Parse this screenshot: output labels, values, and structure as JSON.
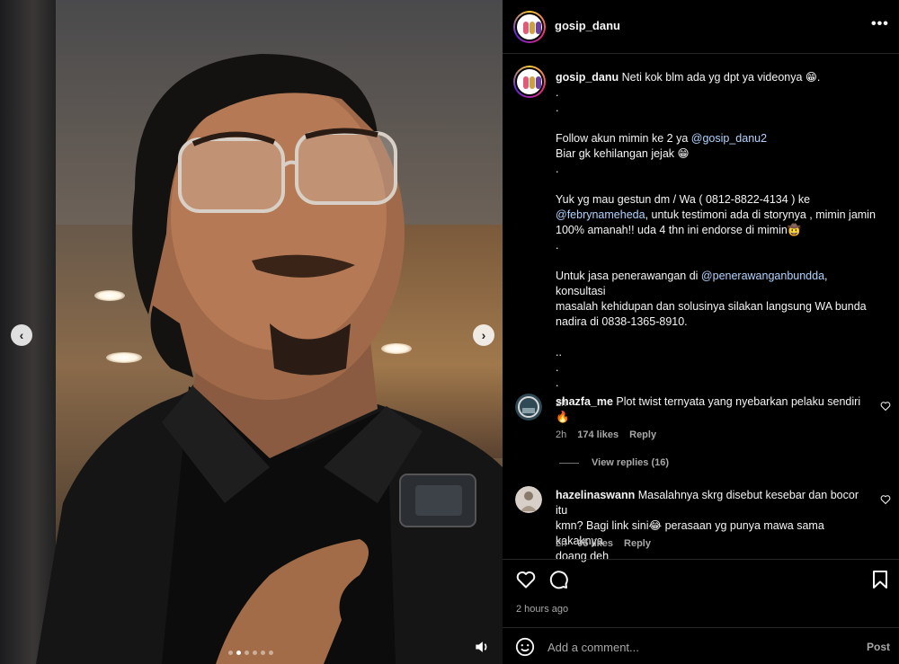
{
  "post": {
    "username": "gosip_danu",
    "more_label": "•••",
    "caption": {
      "username": "gosip_danu",
      "lines": [
        "Neti kok blm ada yg dpt ya videonya 😁.",
        ".",
        ".",
        "",
        "Follow akun mimin ke 2 ya @gosip_danu2",
        "Biar gk kehilangan jejak 😁",
        ".",
        "",
        "Yuk yg mau gestun dm / Wa ( 0812-8822-4134 ) ke",
        "@febrynameheda, untuk testimoni ada di storynya , mimin jamin",
        "100% amanah!! uda 4 thn ini endorse di mimin🤠",
        ".",
        "",
        "Untuk jasa penerawangan di @penerawanganbundda, konsultasi",
        "masalah kehidupan dan solusinya silakan langsung WA bunda",
        "nadira di 0838-1365-8910.",
        "",
        "..",
        ".",
        "."
      ],
      "time": "2h"
    },
    "comments": [
      {
        "username": "shazfa_me",
        "text": "Plot twist ternyata yang nyebarkan pelaku sendiri",
        "text2": "🔥",
        "time": "2h",
        "likes": "174 likes",
        "reply": "Reply",
        "view_replies": "View replies (16)"
      },
      {
        "username": "hazelinaswann",
        "text": "Masalahnya skrg disebut kesebar dan bocor itu",
        "text2": "kmn? Bagi link sini😂  perasaan yg punya mawa sama kakaknya",
        "text3": "doang deh",
        "time": "2h",
        "likes": "95 likes",
        "reply": "Reply"
      }
    ],
    "posted_ago": "2 hours ago",
    "comment_input": {
      "placeholder": "Add a comment...",
      "post_label": "Post"
    },
    "carousel": {
      "dot_count": 6,
      "active_index": 1
    }
  }
}
